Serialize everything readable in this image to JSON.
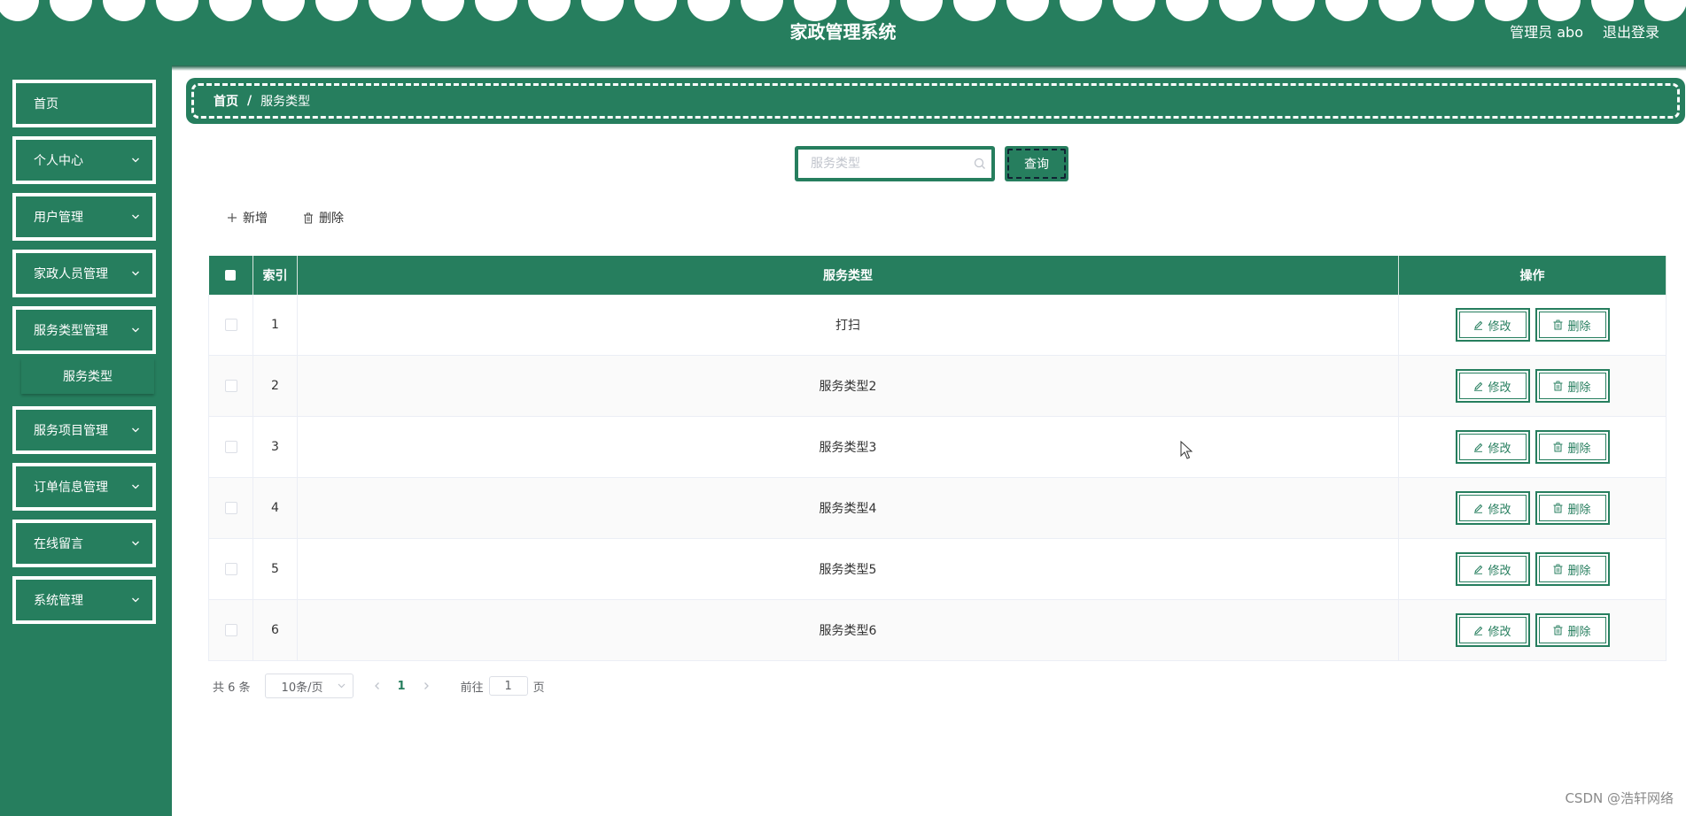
{
  "app": {
    "title": "家政管理系统"
  },
  "header": {
    "admin_label": "管理员 abo",
    "logout_label": "退出登录"
  },
  "sidebar": {
    "items": [
      {
        "label": "首页",
        "has_children": false
      },
      {
        "label": "个人中心",
        "has_children": true
      },
      {
        "label": "用户管理",
        "has_children": true
      },
      {
        "label": "家政人员管理",
        "has_children": true
      },
      {
        "label": "服务类型管理",
        "has_children": true
      },
      {
        "label": "服务项目管理",
        "has_children": true
      },
      {
        "label": "订单信息管理",
        "has_children": true
      },
      {
        "label": "在线留言",
        "has_children": true
      },
      {
        "label": "系统管理",
        "has_children": true
      }
    ],
    "submenu": {
      "label": "服务类型"
    }
  },
  "breadcrumb": {
    "home": "首页",
    "separator": "/",
    "current": "服务类型"
  },
  "search": {
    "placeholder": "服务类型",
    "value": "",
    "button_label": "查询"
  },
  "actions": {
    "add_label": "新增",
    "delete_label": "删除"
  },
  "table": {
    "columns": {
      "index": "索引",
      "service_type": "服务类型",
      "operations": "操作"
    },
    "edit_label": "修改",
    "delete_label": "删除",
    "rows": [
      {
        "index": "1",
        "service_type": "打扫"
      },
      {
        "index": "2",
        "service_type": "服务类型2"
      },
      {
        "index": "3",
        "service_type": "服务类型3"
      },
      {
        "index": "4",
        "service_type": "服务类型4"
      },
      {
        "index": "5",
        "service_type": "服务类型5"
      },
      {
        "index": "6",
        "service_type": "服务类型6"
      }
    ]
  },
  "pagination": {
    "total_text": "共 6 条",
    "page_size_text": "10条/页",
    "current_page": "1",
    "goto_label": "前往",
    "goto_value": "1",
    "page_unit": "页"
  },
  "watermark": "CSDN @浩轩网络",
  "colors": {
    "primary": "#267e5e",
    "white": "#ffffff",
    "border": "#ebeef5"
  },
  "icons": {
    "chevron": "chevron-down-icon",
    "search": "search-icon",
    "add": "plus-icon",
    "delete": "trash-icon",
    "edit": "pencil-icon",
    "cursor": "mouse-cursor-icon"
  }
}
